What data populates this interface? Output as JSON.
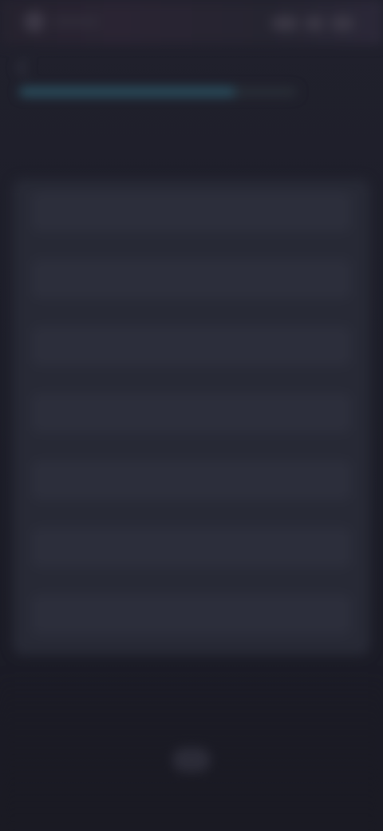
{
  "status_bar": {
    "app_icon": "app-icon",
    "time": ""
  },
  "header": {
    "back_icon": "chevron-left-icon",
    "title": ""
  },
  "progress": {
    "fraction": 0.78
  },
  "question": {
    "text": ""
  },
  "options": [
    {
      "label": ""
    },
    {
      "label": ""
    },
    {
      "label": ""
    },
    {
      "label": ""
    },
    {
      "label": ""
    },
    {
      "label": ""
    },
    {
      "label": ""
    }
  ],
  "colors": {
    "background": "#1b1b25",
    "card": "#272935",
    "option": "#2c2e3b",
    "progress_fill": "#2d5a6a",
    "progress_track": "#2a3038"
  },
  "home_indicator_icon": "home-button-icon"
}
